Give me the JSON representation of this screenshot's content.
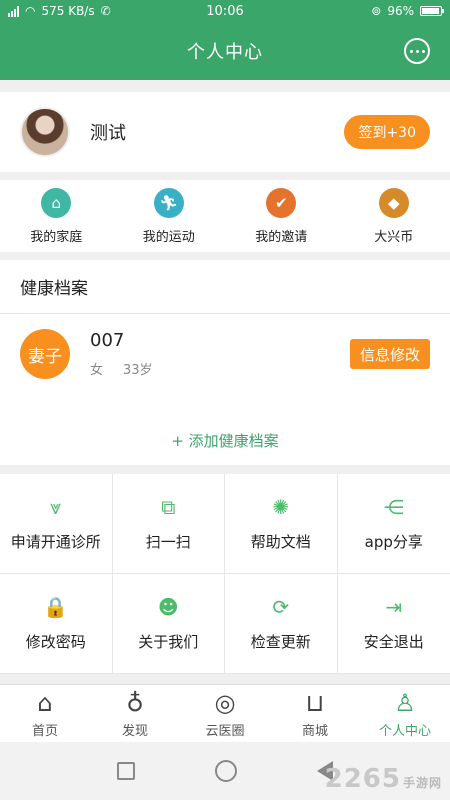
{
  "status_bar": {
    "net_speed": "575 KB/s",
    "time": "10:06",
    "battery": "96%",
    "battery_level": 0.96
  },
  "header": {
    "title": "个人中心",
    "message_icon": "chat-bubble-icon"
  },
  "profile": {
    "username": "测试",
    "checkin_label": "签到+30"
  },
  "quick_links": [
    {
      "label": "我的家庭",
      "icon": "home-icon",
      "color": "#3fb8a3"
    },
    {
      "label": "我的运动",
      "icon": "running-icon",
      "color": "#3ab0c6"
    },
    {
      "label": "我的邀请",
      "icon": "invite-icon",
      "color": "#e5732e"
    },
    {
      "label": "大兴币",
      "icon": "coin-icon",
      "color": "#d68a2a"
    }
  ],
  "health": {
    "title": "健康档案",
    "record": {
      "relation": "妻子",
      "name": "007",
      "gender": "女",
      "age": "33岁",
      "edit_label": "信息修改"
    },
    "add_label": "+ 添加健康档案"
  },
  "grid": [
    {
      "label": "申请开通诊所",
      "icon": "clinic-icon",
      "glyph": "⩔"
    },
    {
      "label": "扫一扫",
      "icon": "scan-icon",
      "glyph": "⧉"
    },
    {
      "label": "帮助文档",
      "icon": "lightbulb-icon",
      "glyph": "✺"
    },
    {
      "label": "app分享",
      "icon": "share-icon",
      "glyph": "⋲"
    },
    {
      "label": "修改密码",
      "icon": "lock-icon",
      "glyph": "🔒"
    },
    {
      "label": "关于我们",
      "icon": "person-icon",
      "glyph": "☻"
    },
    {
      "label": "检查更新",
      "icon": "refresh-icon",
      "glyph": "⟳"
    },
    {
      "label": "安全退出",
      "icon": "logout-icon",
      "glyph": "⇥"
    }
  ],
  "tabs": [
    {
      "label": "首页",
      "icon": "home-tab-icon",
      "glyph": "⌂"
    },
    {
      "label": "发现",
      "icon": "planet-icon",
      "glyph": "♁"
    },
    {
      "label": "云医圈",
      "icon": "circle-icon",
      "glyph": "◎"
    },
    {
      "label": "商城",
      "icon": "shop-icon",
      "glyph": "⊔"
    },
    {
      "label": "个人中心",
      "icon": "user-tab-icon",
      "glyph": "♙",
      "active": true
    }
  ],
  "watermark": {
    "text": "2265",
    "sub": "手游网"
  },
  "colors": {
    "primary": "#3ba66a",
    "accent": "#f7901e"
  }
}
